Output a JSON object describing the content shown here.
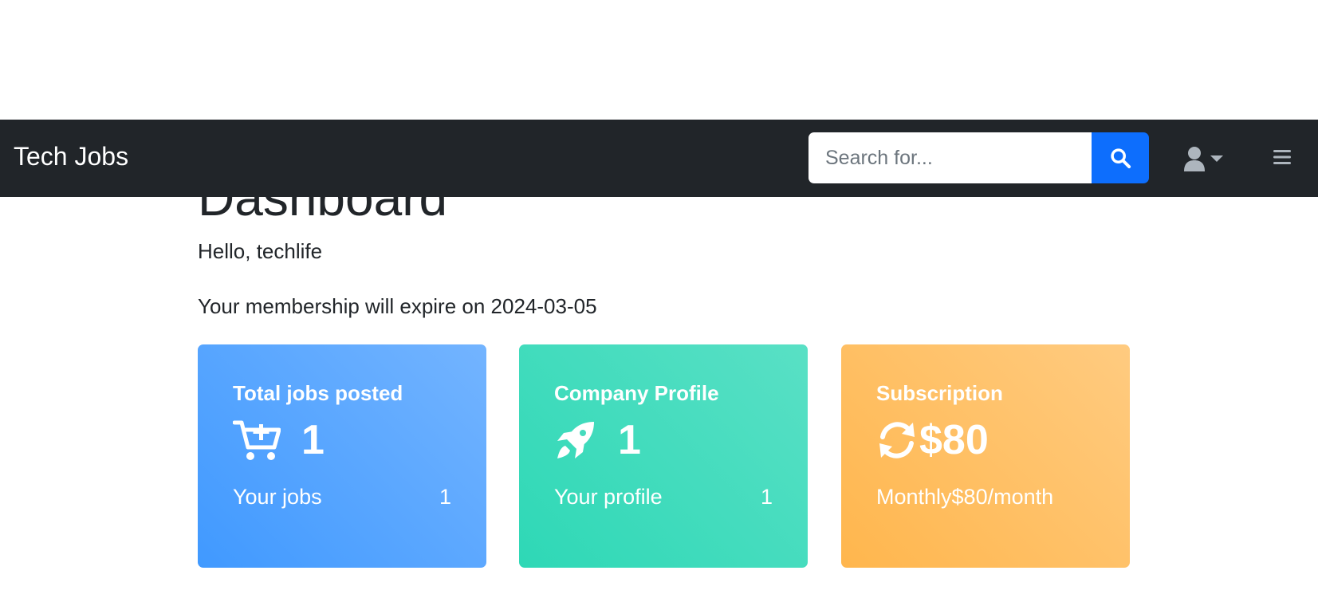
{
  "navbar": {
    "brand": "Tech Jobs",
    "search": {
      "placeholder": "Search for...",
      "value": ""
    }
  },
  "main": {
    "title": "Dashboard",
    "greeting": "Hello, techlife",
    "membership": "Your membership will expire on 2024-03-05"
  },
  "cards": {
    "jobs": {
      "title": "Total jobs posted",
      "value": "1",
      "footer_label": "Your jobs",
      "footer_value": "1",
      "icon": "cart-plus-icon",
      "color_start": "#4099ff",
      "color_end": "#73b4ff"
    },
    "profile": {
      "title": "Company Profile",
      "value": "1",
      "footer_label": "Your profile",
      "footer_value": "1",
      "icon": "rocket-icon",
      "color_start": "#2ed8b6",
      "color_end": "#59e0c5"
    },
    "subscription": {
      "title": "Subscription",
      "value": "$80",
      "footer_text": "Monthly$80/month",
      "icon": "sync-icon",
      "color_start": "#ffb64d",
      "color_end": "#ffcb80"
    }
  },
  "colors": {
    "navbar_bg": "#212529",
    "primary": "#0d6efd"
  }
}
